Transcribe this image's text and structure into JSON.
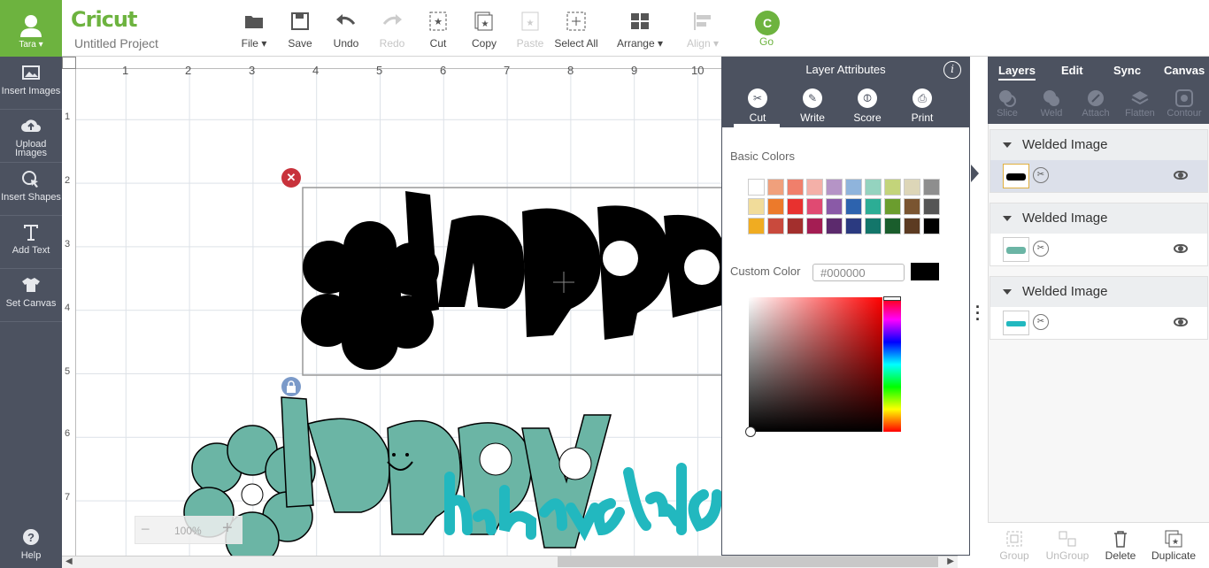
{
  "user": {
    "name": "Tara"
  },
  "brand": {
    "logo": "Cricut",
    "project_title": "Untitled Project"
  },
  "toolbar": [
    {
      "label": "File",
      "icon": "folder-icon",
      "enabled": true,
      "dropdown": true
    },
    {
      "label": "Save",
      "icon": "save-icon",
      "enabled": true
    },
    {
      "label": "Undo",
      "icon": "undo-icon",
      "enabled": true
    },
    {
      "label": "Redo",
      "icon": "redo-icon",
      "enabled": false
    },
    {
      "label": "Cut",
      "icon": "cut-icon",
      "enabled": true
    },
    {
      "label": "Copy",
      "icon": "copy-icon",
      "enabled": true
    },
    {
      "label": "Paste",
      "icon": "paste-icon",
      "enabled": false
    },
    {
      "label": "Select All",
      "icon": "select-all-icon",
      "enabled": true
    },
    {
      "label": "Arrange",
      "icon": "arrange-icon",
      "enabled": true,
      "dropdown": true
    },
    {
      "label": "Align",
      "icon": "align-icon",
      "enabled": false,
      "dropdown": true
    }
  ],
  "go": {
    "label": "Go",
    "icon_letter": "C"
  },
  "sidebar": [
    {
      "label": "Insert Images",
      "icon": "image-icon"
    },
    {
      "label": "Upload Images",
      "icon": "cloud-upload-icon"
    },
    {
      "label": "Insert Shapes",
      "icon": "shapes-icon"
    },
    {
      "label": "Add Text",
      "icon": "text-icon"
    },
    {
      "label": "Set Canvas",
      "icon": "shirt-icon"
    }
  ],
  "help": {
    "label": "Help"
  },
  "rulers": {
    "h": [
      "1",
      "2",
      "3",
      "4",
      "5",
      "6",
      "7",
      "8",
      "9",
      "10"
    ],
    "v": [
      "1",
      "2",
      "3",
      "4",
      "5",
      "6",
      "7"
    ]
  },
  "zoom": {
    "value": "100%",
    "minus": "−",
    "plus": "+"
  },
  "layer_attributes": {
    "title": "Layer Attributes",
    "tabs": [
      {
        "label": "Cut",
        "icon": "scissors-icon"
      },
      {
        "label": "Write",
        "icon": "pen-icon"
      },
      {
        "label": "Score",
        "icon": "score-icon"
      },
      {
        "label": "Print",
        "icon": "printer-icon"
      }
    ],
    "basic_colors_label": "Basic Colors",
    "custom_color_label": "Custom Color",
    "custom_color_value": "#000000",
    "swatches": [
      [
        "#ffffff",
        "#f0a07c",
        "#f07f6b",
        "#f4b0a8",
        "#b594c6",
        "#8fb4dc",
        "#94d3bf",
        "#c3d47a",
        "#ddd6b8",
        "#8e8e8e"
      ],
      [
        "#f1dc9a",
        "#ec7a2b",
        "#e8312f",
        "#e04a72",
        "#8a5aa7",
        "#2d63ae",
        "#2cad95",
        "#6b9d2e",
        "#7a5531",
        "#555555"
      ],
      [
        "#f0ac21",
        "#c94a3d",
        "#a32f2d",
        "#a41d53",
        "#5c2a6d",
        "#2b3a80",
        "#13766a",
        "#1a5d2c",
        "#5c3b22",
        "#000000"
      ]
    ]
  },
  "right_panel": {
    "tabs": [
      "Layers",
      "Edit",
      "Sync",
      "Canvas"
    ],
    "tools": [
      "Slice",
      "Weld",
      "Attach",
      "Flatten",
      "Contour"
    ],
    "layers": [
      {
        "name": "Welded Image",
        "color": "#000000",
        "selected": true
      },
      {
        "name": "Welded Image",
        "color": "#6bb5a5",
        "selected": false
      },
      {
        "name": "Welded Image",
        "color": "#22b8bf",
        "selected": false
      }
    ],
    "bottom": [
      {
        "label": "Group",
        "enabled": false
      },
      {
        "label": "UnGroup",
        "enabled": false
      },
      {
        "label": "Delete",
        "enabled": true
      },
      {
        "label": "Duplicate",
        "enabled": true
      }
    ]
  },
  "colors": {
    "brand_green": "#6db33f",
    "sidebar_bg": "#4c5260",
    "delete_red": "#c8323b",
    "teal_fill": "#6bb5a5",
    "cyan_fill": "#22b8bf"
  }
}
